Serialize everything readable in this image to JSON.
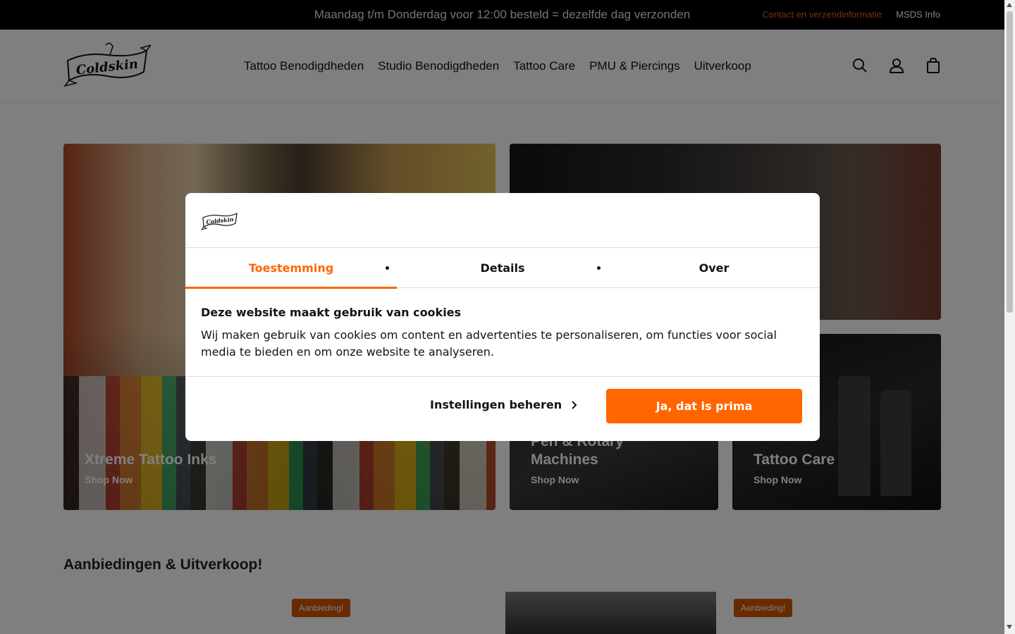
{
  "topbar": {
    "message": "Maandag t/m Donderdag voor 12:00 besteld = dezelfde dag verzonden",
    "contact_link": "Contact en verzendinformatie",
    "msds_link": "MSDS Info"
  },
  "header": {
    "logo_text": "Coldskin",
    "nav": [
      "Tattoo Benodigdheden",
      "Studio Benodigdheden",
      "Tattoo Care",
      "PMU & Piercings",
      "Uitverkoop"
    ],
    "icons": [
      "search-icon",
      "account-icon",
      "cart-icon"
    ]
  },
  "tiles": [
    {
      "title": "Xtreme Tattoo Inks",
      "link": "Shop Now"
    },
    {
      "title": "Pen & Rotary Machines",
      "link": "Shop Now"
    },
    {
      "title": "Tattoo Care",
      "link": "Shop Now"
    }
  ],
  "section": {
    "title": "Aanbiedingen & Uitverkoop!",
    "badge": "Aanbieding!"
  },
  "cookie_modal": {
    "logo_text": "Coldskin",
    "tabs": [
      "Toestemming",
      "Details",
      "Over"
    ],
    "active_tab": "Toestemming",
    "heading": "Deze website maakt gebruik van cookies",
    "text": "Wij maken gebruik van cookies om content en advertenties te personaliseren, om functies voor social media te bieden en om onze website te analyseren.",
    "settings_button": "Instellingen beheren",
    "allow_button": "Ja, dat is prima",
    "accent_color": "#ff6600"
  }
}
